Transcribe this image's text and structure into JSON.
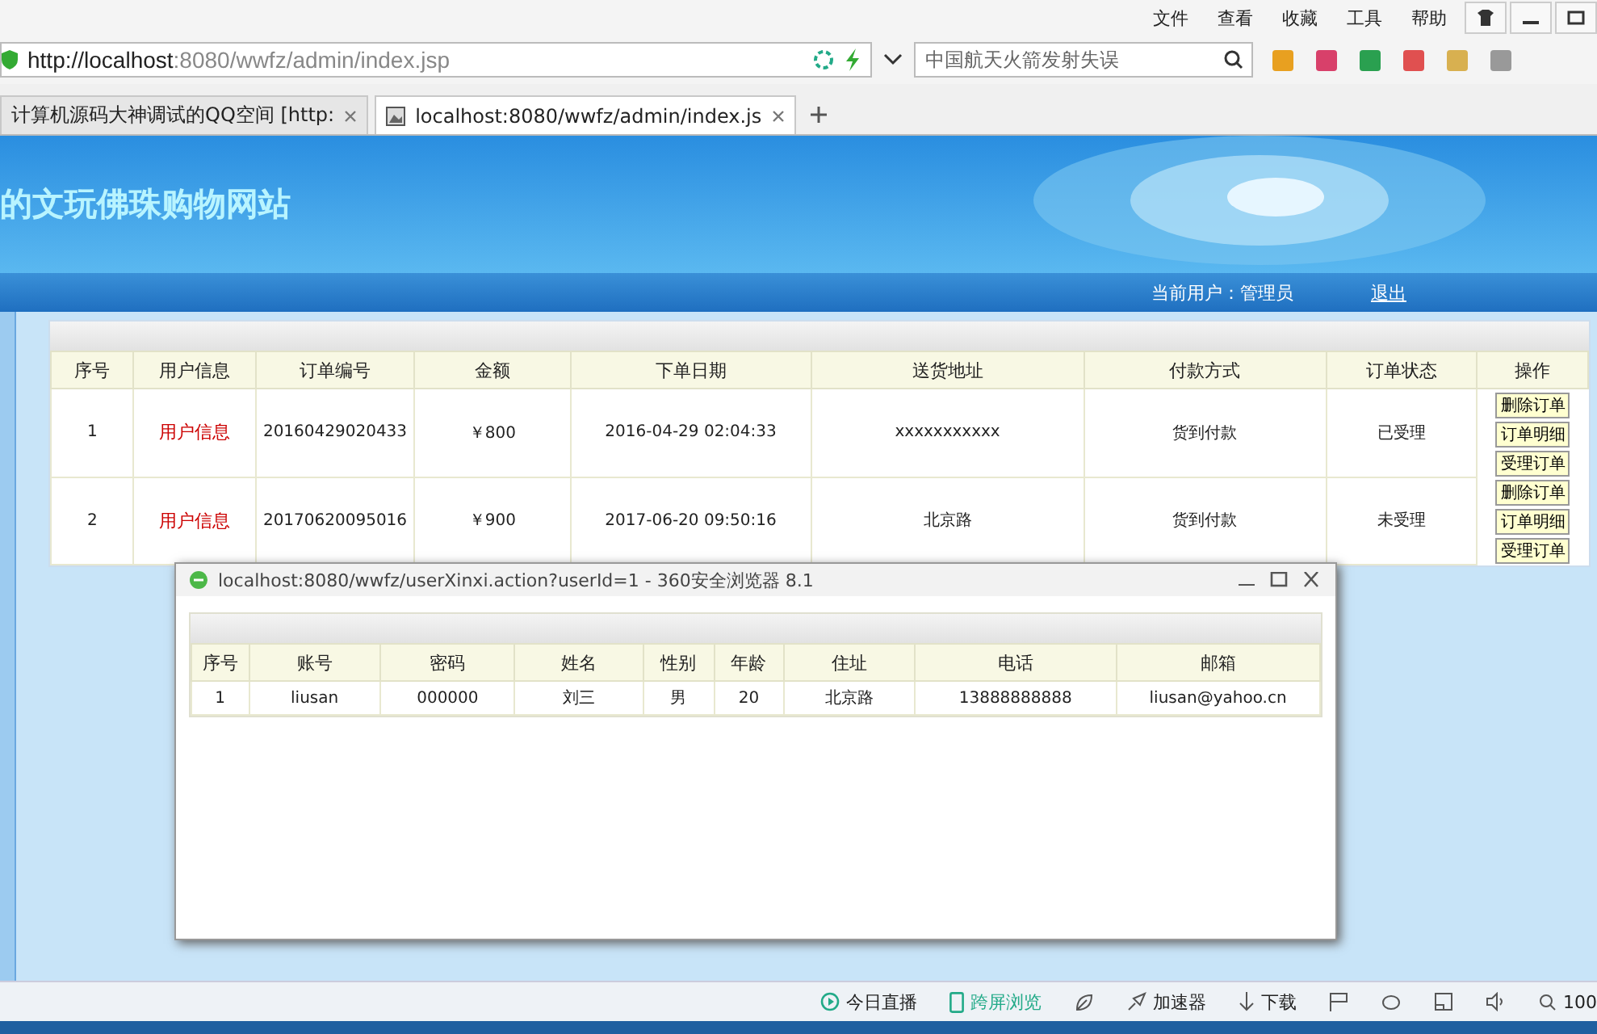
{
  "menu": [
    "文件",
    "查看",
    "收藏",
    "工具",
    "帮助"
  ],
  "address_bar": {
    "url_host": "http://localhost",
    "url_rest": ":8080/wwfz/admin/index.jsp",
    "search_placeholder": "中国航天火箭发射失误"
  },
  "tabs": [
    {
      "label": "计算机源码大神调试的QQ空间 [http:",
      "selected": false
    },
    {
      "label": "localhost:8080/wwfz/admin/index.js",
      "selected": true
    }
  ],
  "site": {
    "title": "的文玩佛珠购物网站",
    "current_user": "当前用户：管理员",
    "logout": "退出"
  },
  "orders": {
    "columns": [
      "序号",
      "用户信息",
      "订单编号",
      "金额",
      "下单日期",
      "送货地址",
      "付款方式",
      "订单状态",
      "操作"
    ],
    "rows": [
      {
        "index": "1",
        "user_info": "用户信息",
        "order_no": "20160429020433",
        "amount": "￥800",
        "date": "2016-04-29 02:04:33",
        "address": "xxxxxxxxxxx",
        "payment": "货到付款",
        "status": "已受理",
        "actions": [
          "删除订单",
          "订单明细",
          "受理订单"
        ]
      },
      {
        "index": "2",
        "user_info": "用户信息",
        "order_no": "20170620095016",
        "amount": "￥900",
        "date": "2017-06-20 09:50:16",
        "address": "北京路",
        "payment": "货到付款",
        "status": "未受理",
        "actions": [
          "删除订单",
          "订单明细",
          "受理订单"
        ]
      }
    ]
  },
  "popup": {
    "title": "localhost:8080/wwfz/userXinxi.action?userId=1 - 360安全浏览器 8.1",
    "columns": [
      "序号",
      "账号",
      "密码",
      "姓名",
      "性别",
      "年龄",
      "住址",
      "电话",
      "邮箱"
    ],
    "rows": [
      [
        "1",
        "liusan",
        "000000",
        "刘三",
        "男",
        "20",
        "北京路",
        "13888888888",
        "liusan@yahoo.cn"
      ]
    ]
  },
  "status_bar": [
    "今日直播",
    "跨屏浏览",
    "加速器",
    "下载",
    "100"
  ]
}
